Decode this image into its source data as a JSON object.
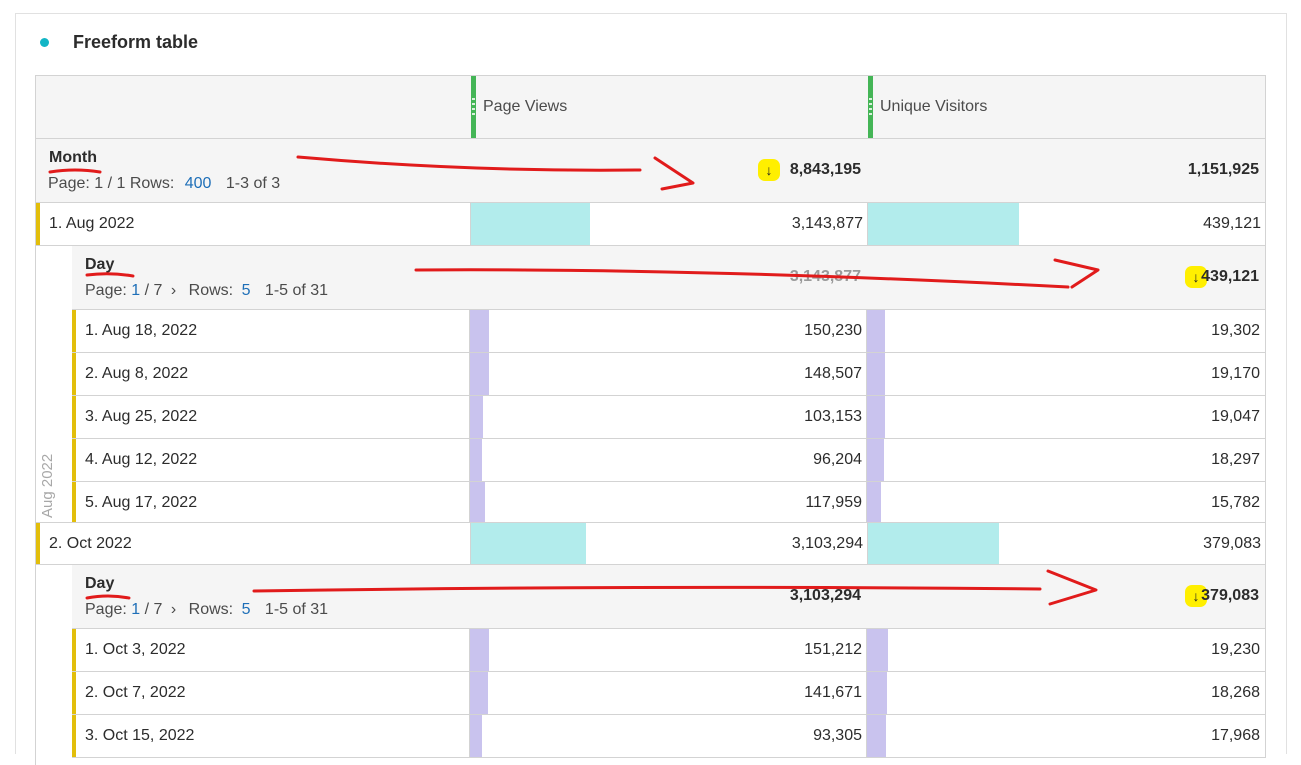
{
  "panel": {
    "title": "Freeform table",
    "accent": "#12b5c5"
  },
  "columns": [
    {
      "label": "Page Views"
    },
    {
      "label": "Unique Visitors"
    }
  ],
  "month_dim": {
    "name": "Month",
    "page_label": "Page: 1 / 1",
    "rows_label": "Rows:",
    "rows_value": "400",
    "range": "1-3 of 3",
    "totals": [
      "8,843,195",
      "1,151,925"
    ],
    "sorted_icon": "sort-descending-icon"
  },
  "groups": [
    {
      "label": "1.  Aug 2022",
      "side_label": "Aug 2022",
      "values": [
        "3,143,877",
        "439,121"
      ],
      "fill": [
        0.3,
        0.38
      ],
      "day_dim": {
        "name": "Day",
        "page_prefix": "Page:",
        "page_current": "1",
        "page_total": "/ 7",
        "rows_label": "Rows:",
        "rows_value": "5",
        "range": "1-5 of 31",
        "totals": [
          "3,143,877",
          "439,121"
        ]
      },
      "rows": [
        {
          "label": "1.  Aug 18, 2022",
          "values": [
            "150,230",
            "19,302"
          ],
          "fill": [
            0.048,
            0.045
          ]
        },
        {
          "label": "2.  Aug 8, 2022",
          "values": [
            "148,507",
            "19,170"
          ],
          "fill": [
            0.047,
            0.044
          ]
        },
        {
          "label": "3.  Aug 25, 2022",
          "values": [
            "103,153",
            "19,047"
          ],
          "fill": [
            0.033,
            0.044
          ]
        },
        {
          "label": "4.  Aug 12, 2022",
          "values": [
            "96,204",
            "18,297"
          ],
          "fill": [
            0.031,
            0.042
          ]
        },
        {
          "label": "5.  Aug 17, 2022",
          "values": [
            "117,959",
            "15,782"
          ],
          "fill": [
            0.038,
            0.036
          ]
        }
      ]
    },
    {
      "label": "2.  Oct 2022",
      "values": [
        "3,103,294",
        "379,083"
      ],
      "fill": [
        0.29,
        0.33
      ],
      "day_dim": {
        "name": "Day",
        "page_prefix": "Page:",
        "page_current": "1",
        "page_total": "/ 7",
        "rows_label": "Rows:",
        "rows_value": "5",
        "range": "1-5 of 31",
        "totals": [
          "3,103,294",
          "379,083"
        ]
      },
      "rows": [
        {
          "label": "1.  Oct 3, 2022",
          "values": [
            "151,212",
            "19,230"
          ],
          "fill": [
            0.048,
            0.052
          ]
        },
        {
          "label": "2.  Oct 7, 2022",
          "values": [
            "141,671",
            "18,268"
          ],
          "fill": [
            0.045,
            0.049
          ]
        },
        {
          "label": "3.  Oct 15, 2022",
          "values": [
            "93,305",
            "17,968"
          ],
          "fill": [
            0.03,
            0.048
          ]
        }
      ]
    }
  ],
  "icons": {
    "chevron": "›",
    "sort_down": "↓"
  },
  "colors": {
    "teal_bar": "#b2ecec",
    "lavender_bar": "#c9c3ee",
    "row_rail": "#e2be0b",
    "column_handle": "#44b556",
    "highlight": "#ffef00",
    "annotation": "#e11b1b"
  }
}
